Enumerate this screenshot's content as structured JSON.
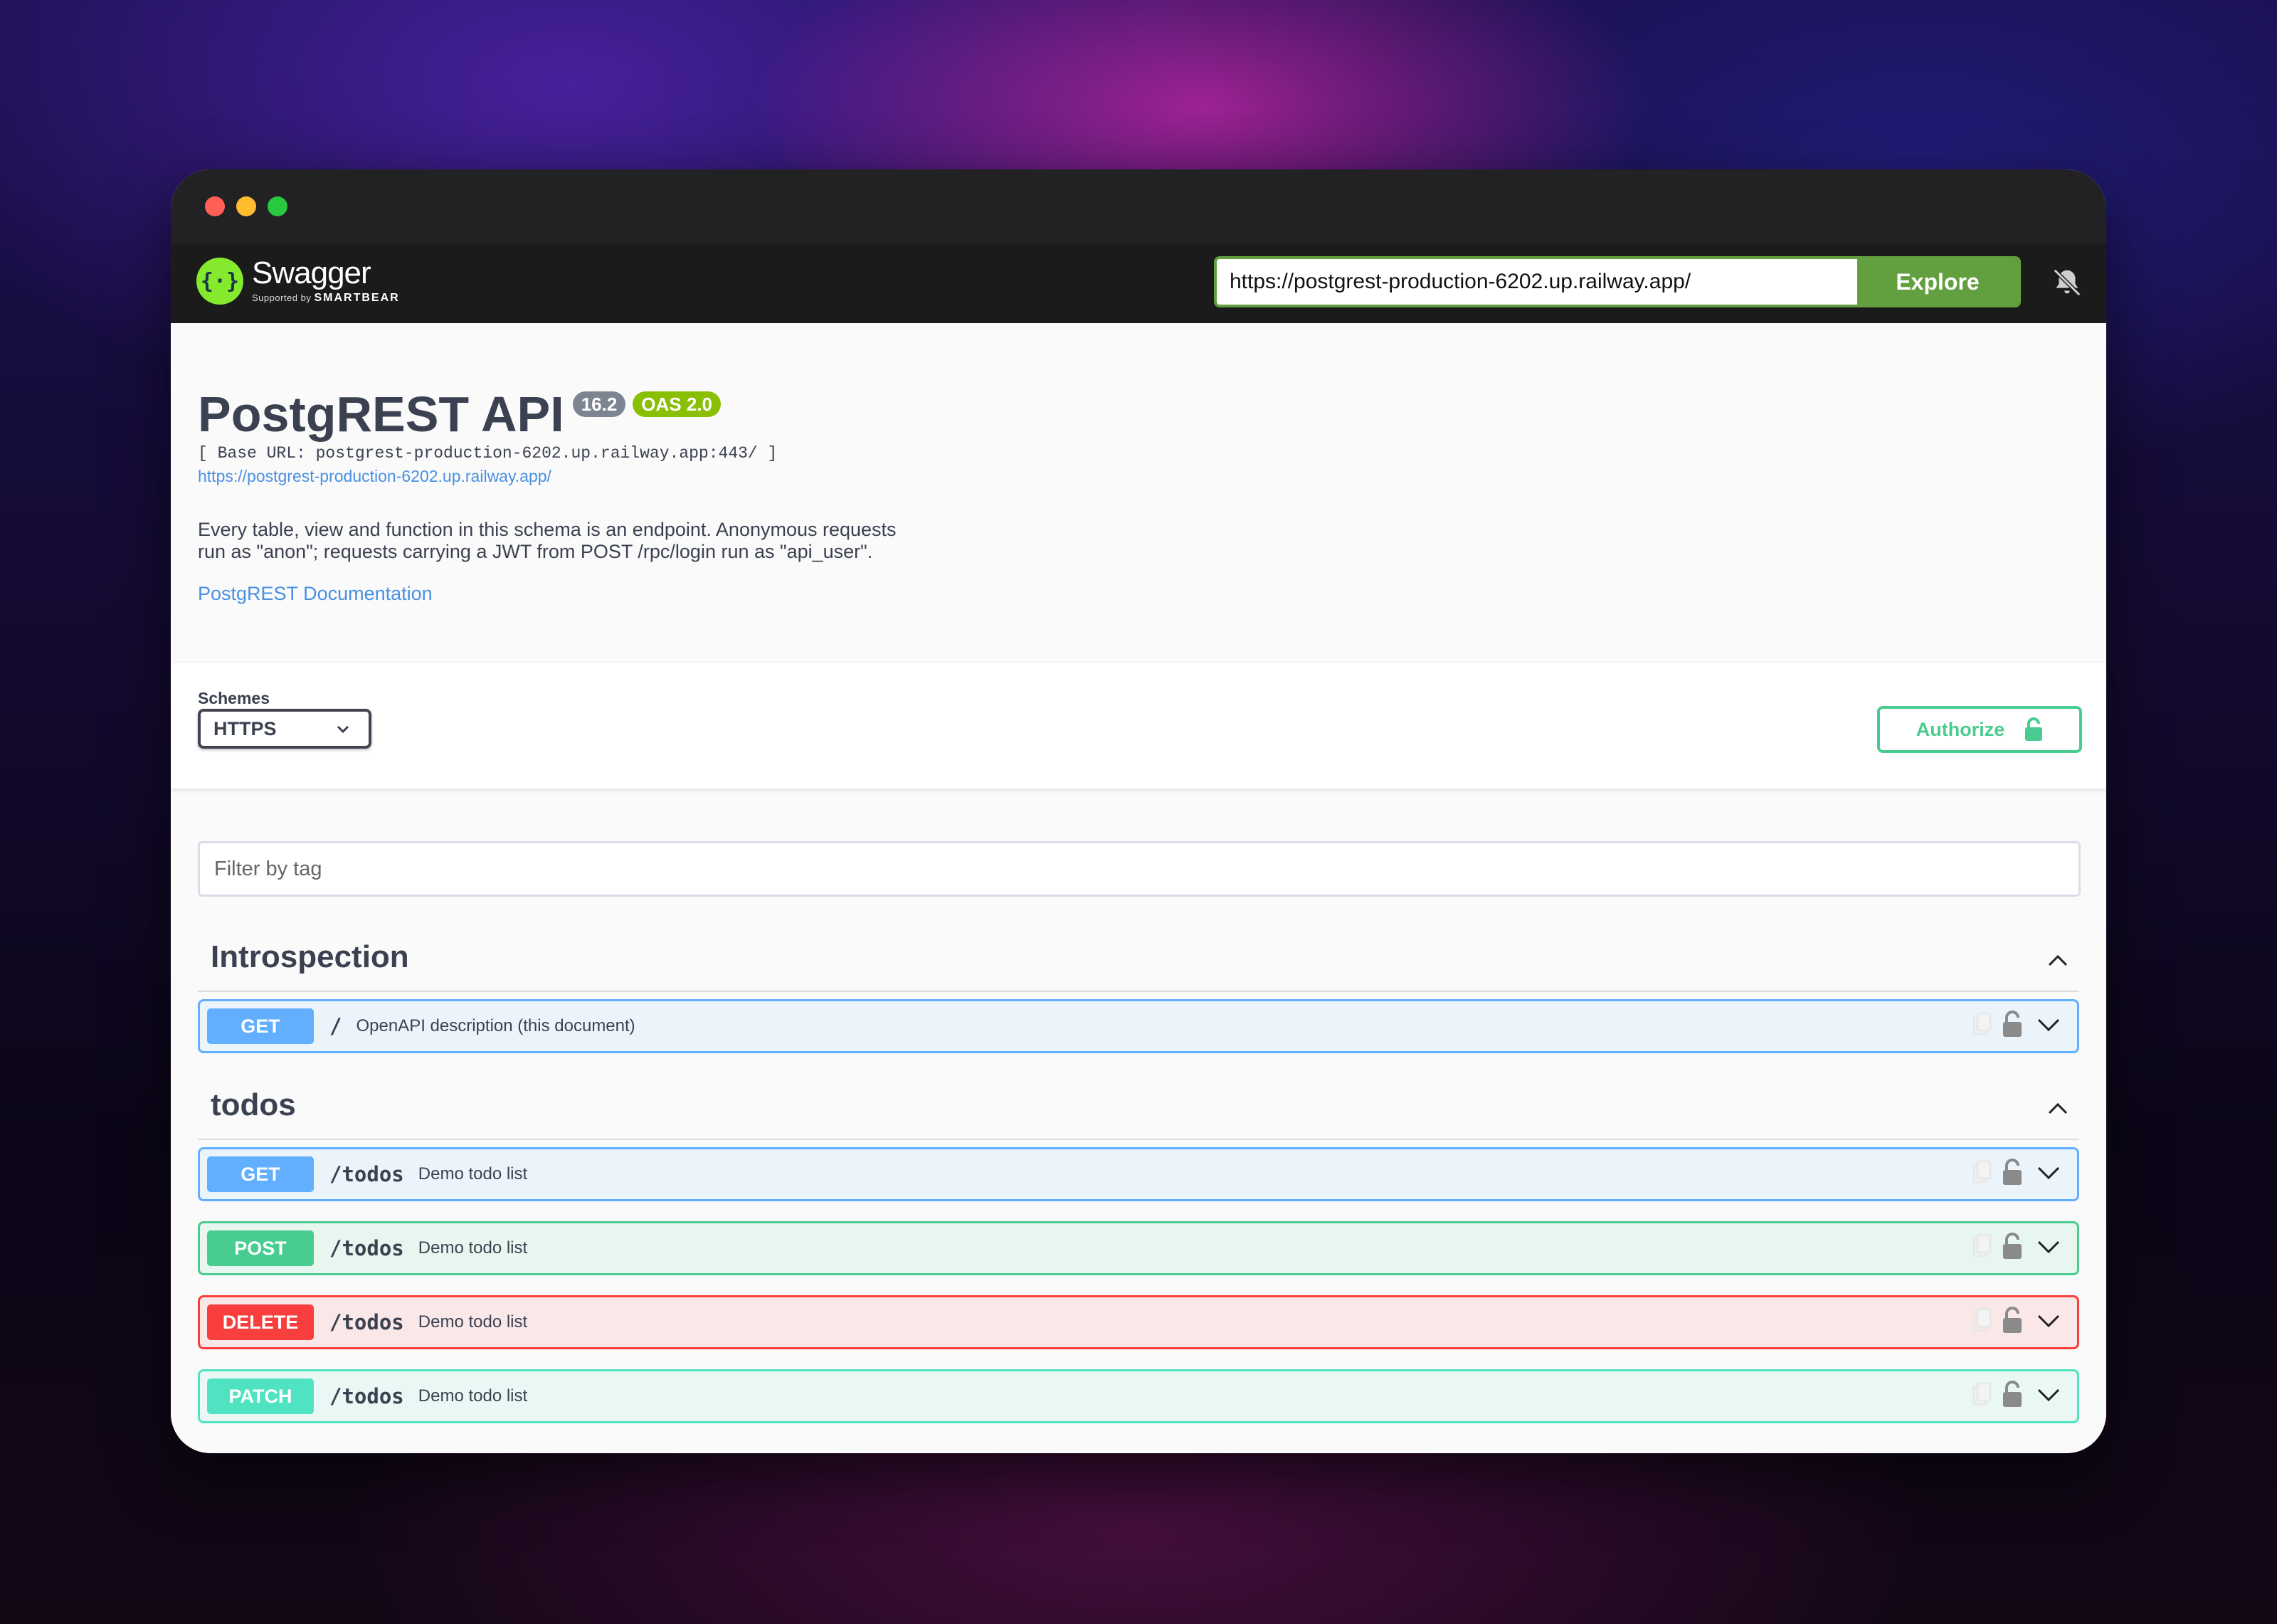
{
  "topbar": {
    "logo_name": "Swagger",
    "logo_sub": "Supported by",
    "logo_sub_brand": "SMARTBEAR",
    "url_value": "https://postgrest-production-6202.up.railway.app/",
    "explore_label": "Explore"
  },
  "info": {
    "title": "PostgREST API",
    "version": "16.2",
    "oas": "OAS 2.0",
    "base_url": "[ Base URL: postgrest-production-6202.up.railway.app:443/ ]",
    "spec_link": "https://postgrest-production-6202.up.railway.app/",
    "description": "Every table, view and function in this schema is an endpoint. Anonymous requests run as \"anon\"; requests carrying a JWT from POST /rpc/login run as \"api_user\".",
    "doc_link": "PostgREST Documentation"
  },
  "schemes": {
    "label": "Schemes",
    "selected": "HTTPS",
    "authorize_label": "Authorize"
  },
  "filter": {
    "placeholder": "Filter by tag"
  },
  "tags": [
    {
      "name": "Introspection",
      "ops": [
        {
          "method": "GET",
          "path": "/",
          "summary": "OpenAPI description (this document)"
        }
      ]
    },
    {
      "name": "todos",
      "ops": [
        {
          "method": "GET",
          "path": "/todos",
          "summary": "Demo todo list"
        },
        {
          "method": "POST",
          "path": "/todos",
          "summary": "Demo todo list"
        },
        {
          "method": "DELETE",
          "path": "/todos",
          "summary": "Demo todo list"
        },
        {
          "method": "PATCH",
          "path": "/todos",
          "summary": "Demo todo list"
        }
      ]
    }
  ],
  "colors": {
    "get": "#61affe",
    "post": "#49cc90",
    "delete": "#f93e3e",
    "patch": "#50e3c2",
    "explore": "#62a03f",
    "brand": "#85ea2d"
  },
  "icons": [
    "swagger-logo-icon",
    "bell-off-icon",
    "chevron-down-icon",
    "lock-icon",
    "chevron-up-icon",
    "copy-icon"
  ]
}
